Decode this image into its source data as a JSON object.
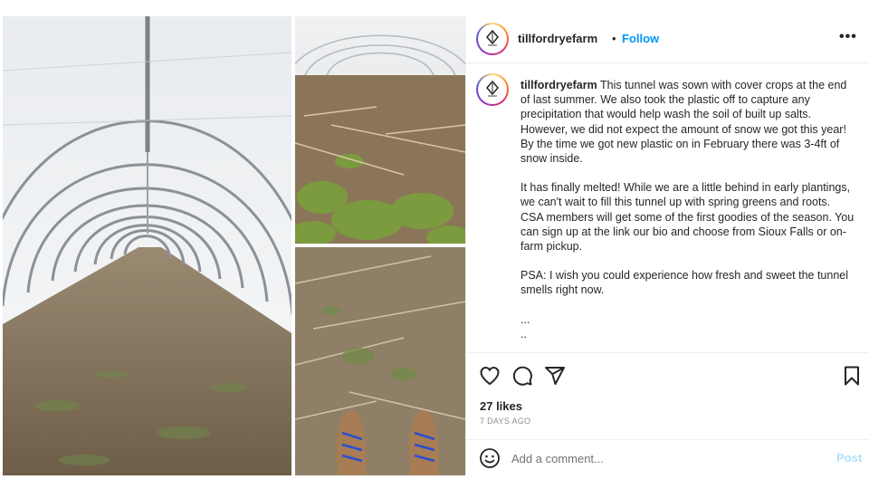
{
  "post": {
    "username": "tillfordryefarm",
    "separator": "•",
    "follow_label": "Follow",
    "more_label": "•••",
    "caption_username": "tillfordryefarm",
    "caption_p1": "This tunnel was sown with cover crops at the end of last summer. We also took the plastic off to capture any precipitation that would help wash the soil of built up salts. However, we did not expect the amount of snow we got this year! By the time we got new plastic on in February there was 3-4ft of snow inside.",
    "caption_p2": "It has finally melted! While we are a little behind in early plantings, we can't wait to fill this tunnel up with spring greens and roots. CSA members will get some of the first goodies of the season. You can sign up at the link our bio and choose from Sioux Falls or on-farm pickup.",
    "caption_p3": "PSA: I wish you could experience how fresh and sweet the tunnel smells right now.",
    "caption_ellipsis1": "...",
    "caption_ellipsis2": "..",
    "likes": "27 likes",
    "timestamp": "7 DAYS AGO"
  },
  "comment": {
    "placeholder": "Add a comment...",
    "post_label": "Post"
  },
  "icons": {
    "like": "heart-icon",
    "comment": "comment-bubble-icon",
    "share": "paper-plane-icon",
    "save": "bookmark-icon",
    "emoji": "smiley-face-icon",
    "more": "more-options-icon"
  },
  "colors": {
    "accent": "#0095f6",
    "post_disabled": "#b2dffc",
    "text": "#262626",
    "muted": "#8e8e8e",
    "divider": "#efefef"
  }
}
